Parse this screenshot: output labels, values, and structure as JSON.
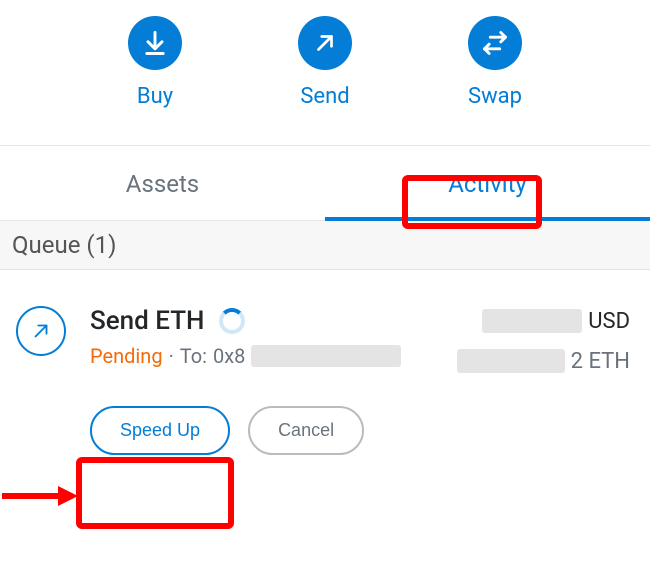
{
  "actions": {
    "buy": "Buy",
    "send": "Send",
    "swap": "Swap"
  },
  "tabs": {
    "assets": "Assets",
    "activity": "Activity"
  },
  "queue_label": "Queue (1)",
  "transaction": {
    "title": "Send ETH",
    "status": "Pending",
    "to_label": "To:",
    "to_prefix": "0x8",
    "fiat_unit": "USD",
    "crypto_unit_suffix": "2 ETH",
    "speed_up": "Speed Up",
    "cancel": "Cancel"
  }
}
